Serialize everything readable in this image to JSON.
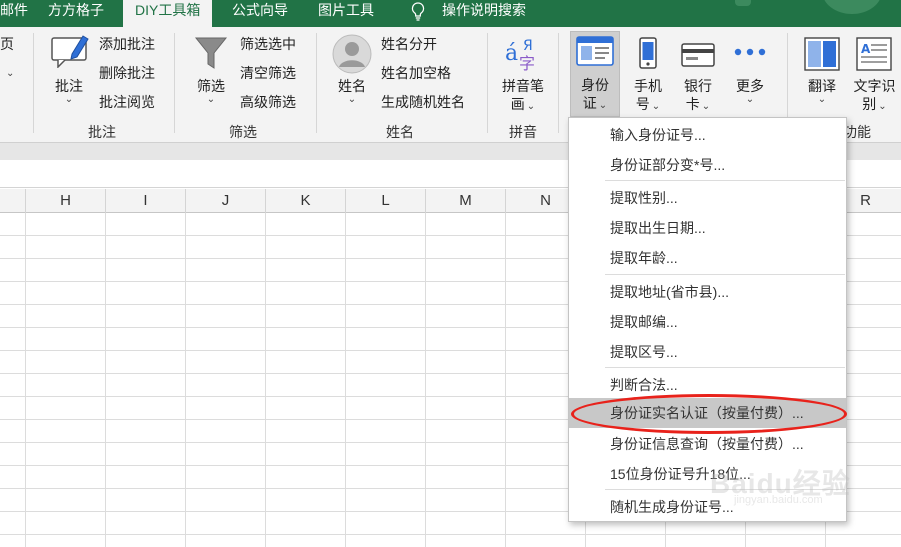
{
  "tabs": [
    {
      "label": "邮件"
    },
    {
      "label": "方方格子"
    },
    {
      "label": "DIY工具箱",
      "active": true
    },
    {
      "label": "公式向导"
    },
    {
      "label": "图片工具"
    },
    {
      "label": "操作说明搜索"
    }
  ],
  "ribbon": {
    "left_edge": {
      "label": "页",
      "caret": "⌄"
    },
    "comment_group": {
      "large_btn": "批注",
      "items": [
        "添加批注",
        "删除批注",
        "批注阅览"
      ],
      "label": "批注"
    },
    "filter_group": {
      "large_btn": "筛选",
      "items": [
        "筛选选中",
        "清空筛选",
        "高级筛选"
      ],
      "label": "筛选"
    },
    "name_group": {
      "large_btn": "姓名",
      "items": [
        "姓名分开",
        "姓名加空格",
        "生成随机姓名"
      ],
      "label": "姓名"
    },
    "pinyin_group": {
      "large_btn_line1": "拼音笔",
      "large_btn_line2": "画",
      "label": "拼音"
    },
    "id_group": {
      "id_btn_line1": "身份",
      "id_btn_line2": "证",
      "phone_line1": "手机",
      "phone_line2": "号",
      "bank_line1": "银行",
      "bank_line2": "卡",
      "more": "更多"
    },
    "func_group": {
      "translate": "翻译",
      "ocr_line1": "文字识",
      "ocr_line2": "别",
      "label": "功能"
    }
  },
  "columns": [
    "H",
    "I",
    "J",
    "K",
    "L",
    "M",
    "N",
    "R"
  ],
  "menu": {
    "items": [
      "输入身份证号...",
      "身份证部分变*号...",
      "提取性别...",
      "提取出生日期...",
      "提取年龄...",
      "提取地址(省市县)...",
      "提取邮编...",
      "提取区号...",
      "判断合法...",
      "身份证实名认证（按量付费）...",
      "身份证信息查询（按量付费）...",
      "15位身份证号升18位...",
      "随机生成身份证号..."
    ],
    "highlighted_index": 9
  },
  "watermark": {
    "text": "Baidu经验",
    "url": "jingyan.baidu.com"
  },
  "colors": {
    "accent": "#217346",
    "highlight_ring": "#e8221b"
  }
}
